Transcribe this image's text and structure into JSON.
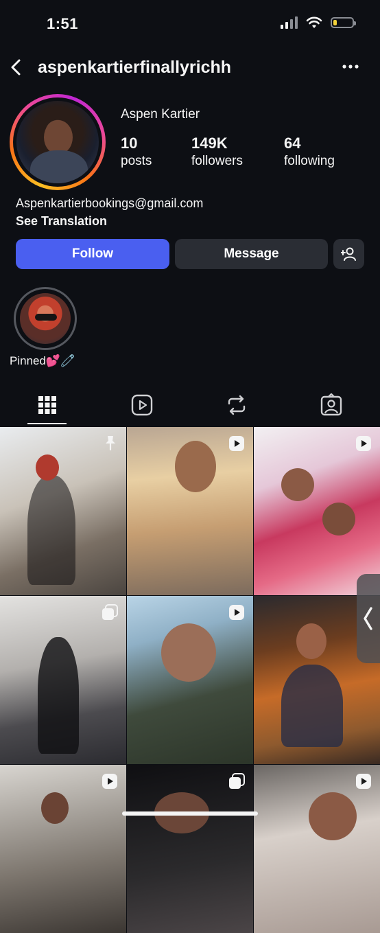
{
  "status_bar": {
    "time": "1:51",
    "battery_percent": 20,
    "signal_bars": 2
  },
  "header": {
    "username": "aspenkartierfinallyrichh",
    "back_icon": "chevron-left-icon",
    "more_icon": "ellipsis-icon"
  },
  "profile": {
    "display_name": "Aspen Kartier",
    "stats": [
      {
        "value": "10",
        "label": "posts"
      },
      {
        "value": "149K",
        "label": "followers"
      },
      {
        "value": "64",
        "label": "following"
      }
    ],
    "bio_email": "Aspenkartierbookings@gmail.com",
    "see_translation": "See Translation"
  },
  "actions": {
    "follow": "Follow",
    "message": "Message",
    "add_user_icon": "person-add-icon"
  },
  "highlights": [
    {
      "label": "Pinned💕🧷"
    }
  ],
  "tabs": [
    "grid-icon",
    "reels-icon",
    "reposts-icon",
    "tagged-icon"
  ],
  "grid": [
    {
      "badge": "pin-icon"
    },
    {
      "badge": "reel-icon"
    },
    {
      "badge": "reel-icon"
    },
    {
      "badge": "carousel-icon"
    },
    {
      "badge": "reel-icon"
    },
    {
      "badge": ""
    },
    {
      "badge": "reel-icon"
    },
    {
      "badge": "carousel-icon"
    },
    {
      "badge": "reel-icon"
    }
  ],
  "colors": {
    "background": "#0d0f14",
    "follow_button": "#4a5ff0",
    "secondary_button": "#2a2d34"
  }
}
